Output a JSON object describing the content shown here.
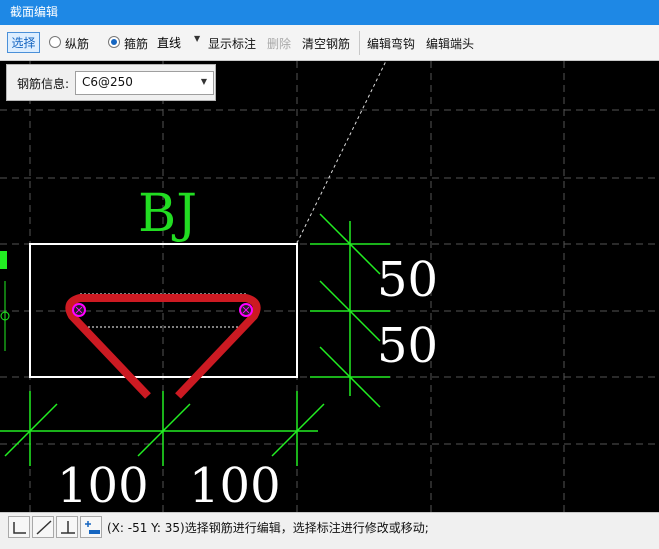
{
  "window": {
    "title": "截面编辑"
  },
  "toolbar": {
    "select_label": "选择",
    "longitudinal_label": "纵筋",
    "stirrup_label": "箍筋",
    "line_type_value": "直线",
    "show_annotation_label": "显示标注",
    "delete_label": "删除",
    "clear_rebar_label": "清空钢筋",
    "edit_hook_label": "编辑弯钩",
    "edit_end_label": "编辑端头",
    "radio_selected": "箍筋"
  },
  "rebar_info": {
    "label": "钢筋信息:",
    "value": "C6@250"
  },
  "drawing": {
    "section_name": "BJ",
    "dim_right_top": "50",
    "dim_right_bottom": "50",
    "dim_bottom_left": "100",
    "dim_bottom_right": "100",
    "colors": {
      "background": "#000000",
      "dim_lines": "#22ee22",
      "rebar": "#cc1a22",
      "outline": "#ffffff",
      "bar_marker": "#ff00ff"
    }
  },
  "status": {
    "text": "(X: -51 Y: 35)选择钢筋进行编辑，选择标注进行修改或移动;",
    "tools": [
      "ortho-icon",
      "angle-line-icon",
      "perpendicular-icon",
      "add-dimension-icon"
    ]
  }
}
